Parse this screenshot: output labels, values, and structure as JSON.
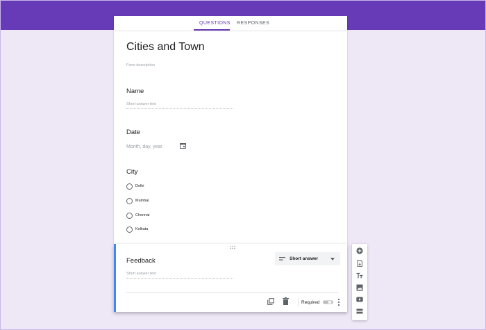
{
  "tabs": {
    "questions": "QUESTIONS",
    "responses": "RESPONSES"
  },
  "form": {
    "title": "Cities and Town",
    "description_placeholder": "Form description"
  },
  "questions": {
    "name": {
      "label": "Name",
      "placeholder": "Short answer text"
    },
    "date": {
      "label": "Date",
      "placeholder": "Month, day, year"
    },
    "city": {
      "label": "City",
      "options": [
        "Delhi",
        "Mumbai",
        "Chennai",
        "Kolkata"
      ]
    },
    "feedback": {
      "label": "Feedback",
      "placeholder": "Short answer text",
      "type_label": "Short answer",
      "required_label": "Required",
      "required": false
    }
  },
  "colors": {
    "brand": "#673ab7",
    "background": "#ede7f6",
    "active_border": "#4285f4"
  },
  "icons": {
    "calendar": "calendar-icon",
    "drag": "drag-handle-icon",
    "type": "short-text-icon",
    "copy": "copy-icon",
    "delete": "trash-icon",
    "more": "more-vert-icon",
    "toolbar": [
      "add-question-icon",
      "import-questions-icon",
      "add-title-icon",
      "add-image-icon",
      "add-video-icon",
      "add-section-icon"
    ]
  }
}
